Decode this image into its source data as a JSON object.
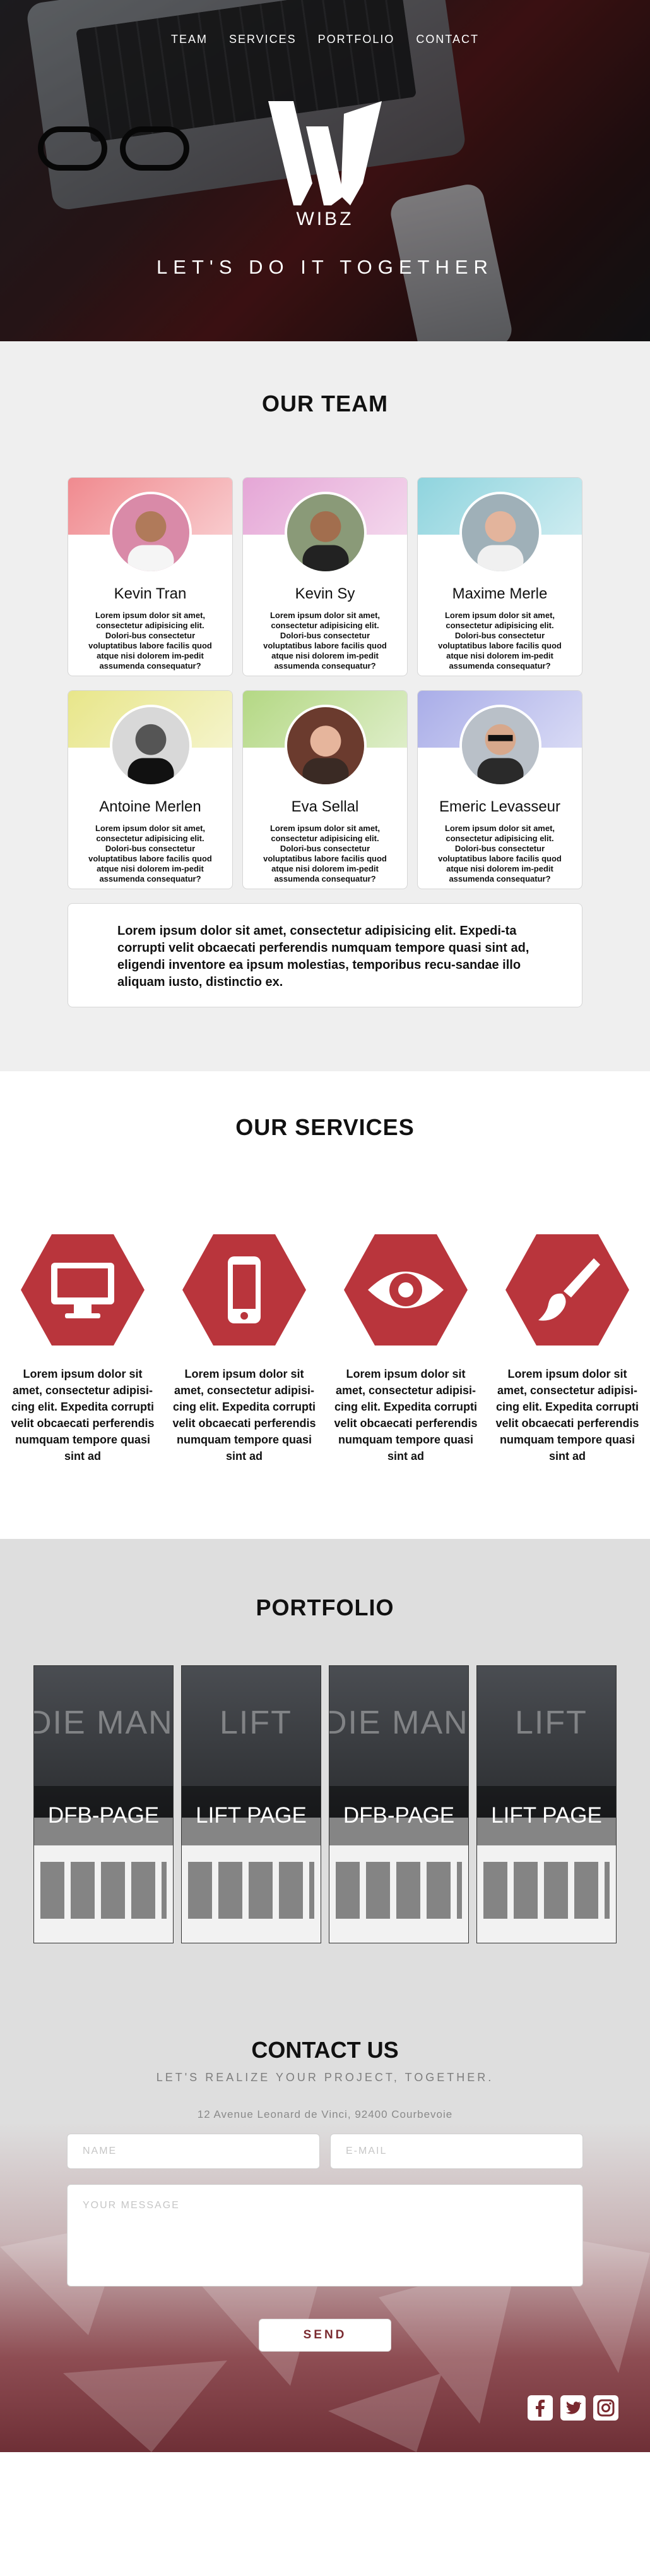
{
  "nav": {
    "items": [
      "TEAM",
      "SERVICES",
      "PORTFOLIO",
      "CONTACT"
    ]
  },
  "hero": {
    "brand": "WIBZ",
    "tagline": "LET'S DO IT TOGETHER"
  },
  "team": {
    "title": "OUR TEAM",
    "members": [
      {
        "name": "Kevin Tran",
        "bio": "Lorem ipsum dolor sit amet, consectetur adipisicing elit. Dolori-bus consectetur voluptatibus labore facilis quod atque nisi dolorem im-pedit assumenda consequatur?",
        "band": "#f08a8f"
      },
      {
        "name": "Kevin Sy",
        "bio": "Lorem ipsum dolor sit amet, consectetur adipisicing elit. Dolori-bus consectetur voluptatibus labore facilis quod atque nisi dolorem im-pedit assumenda consequatur?",
        "band": "#e5a6d6"
      },
      {
        "name": "Maxime Merle",
        "bio": "Lorem ipsum dolor sit amet, consectetur adipisicing elit. Dolori-bus consectetur voluptatibus labore facilis quod atque nisi dolorem im-pedit assumenda consequatur?",
        "band": "#8fd4de"
      },
      {
        "name": "Antoine Merlen",
        "bio": "Lorem ipsum dolor sit amet, consectetur adipisicing elit. Dolori-bus consectetur voluptatibus labore facilis quod atque nisi dolorem im-pedit assumenda consequatur?",
        "band": "#e8e68a"
      },
      {
        "name": "Eva Sellal",
        "bio": "Lorem ipsum dolor sit amet, consectetur adipisicing elit. Dolori-bus consectetur voluptatibus labore facilis quod atque nisi dolorem im-pedit assumenda consequatur?",
        "band": "#b4d884"
      },
      {
        "name": "Emeric Levasseur",
        "bio": "Lorem ipsum dolor sit amet, consectetur adipisicing elit. Dolori-bus consectetur voluptatibus labore facilis quod atque nisi dolorem im-pedit assumenda consequatur?",
        "band": "#a9ade8"
      }
    ],
    "about": "Lorem ipsum dolor sit amet, consectetur adipisicing elit. Expedi-ta corrupti velit obcaecati perferendis numquam tempore quasi sint ad, eligendi inventore ea ipsum molestias, temporibus recu-sandae illo aliquam iusto, distinctio ex."
  },
  "services": {
    "title": "OUR SERVICES",
    "accent": "#b9353c",
    "items": [
      {
        "icon": "monitor-icon",
        "text": "Lorem ipsum dolor sit amet, consectetur adipisi-cing elit. Expedita corrupti velit obcaecati perferendis numquam tempore quasi sint ad"
      },
      {
        "icon": "phone-icon",
        "text": "Lorem ipsum dolor sit amet, consectetur adipisi-cing elit. Expedita corrupti velit obcaecati perferendis numquam tempore quasi sint ad"
      },
      {
        "icon": "eye-icon",
        "text": "Lorem ipsum dolor sit amet, consectetur adipisi-cing elit. Expedita corrupti velit obcaecati perferendis numquam tempore quasi sint ad"
      },
      {
        "icon": "paintbrush-icon",
        "text": "Lorem ipsum dolor sit amet, consectetur adipisi-cing elit. Expedita corrupti velit obcaecati perferendis numquam tempore quasi sint ad"
      }
    ]
  },
  "portfolio": {
    "title": "PORTFOLIO",
    "items": [
      {
        "label": "DFB-PAGE",
        "bg_text": "DIE MANNSCHAFT"
      },
      {
        "label": "LIFT PAGE",
        "bg_text": "LIFT"
      },
      {
        "label": "DFB-PAGE",
        "bg_text": "DIE MANNSCHAFT"
      },
      {
        "label": "LIFT PAGE",
        "bg_text": "LIFT"
      }
    ]
  },
  "contact": {
    "title": "CONTACT US",
    "subtitle": "LET'S REALIZE YOUR PROJECT, TOGETHER.",
    "address": "12 Avenue Leonard de Vinci, 92400 Courbevoie",
    "name_placeholder": "NAME",
    "email_placeholder": "E-MAIL",
    "message_placeholder": "YOUR MESSAGE",
    "send_label": "SEND",
    "social": [
      "facebook-icon",
      "twitter-icon",
      "instagram-icon"
    ]
  }
}
